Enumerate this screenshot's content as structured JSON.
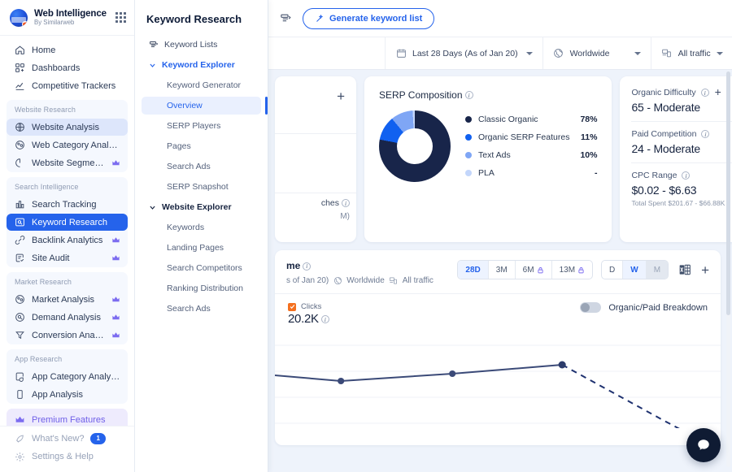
{
  "brand": {
    "name": "Web Intelligence",
    "sub": "By Similarweb"
  },
  "sidebar": {
    "top_items": [
      {
        "label": "Home",
        "icon": "home-icon"
      },
      {
        "label": "Dashboards",
        "icon": "dashboards-icon"
      },
      {
        "label": "Competitive Trackers",
        "icon": "trackers-icon"
      }
    ],
    "groups": [
      {
        "label": "Website Research",
        "items": [
          {
            "label": "Website Analysis",
            "icon": "globe-icon",
            "selected": true,
            "premium": false
          },
          {
            "label": "Web Category Analysis",
            "icon": "category-icon",
            "selected": false,
            "premium": false
          },
          {
            "label": "Website Segments",
            "icon": "segments-icon",
            "selected": false,
            "premium": true
          }
        ]
      },
      {
        "label": "Search Intelligence",
        "items": [
          {
            "label": "Search Tracking",
            "icon": "bars-icon",
            "selected": false,
            "premium": false
          },
          {
            "label": "Keyword Research",
            "icon": "keyword-icon",
            "selected": "hard",
            "premium": false
          },
          {
            "label": "Backlink Analytics",
            "icon": "link-icon",
            "selected": false,
            "premium": true
          },
          {
            "label": "Site Audit",
            "icon": "audit-icon",
            "selected": false,
            "premium": true
          }
        ]
      },
      {
        "label": "Market Research",
        "items": [
          {
            "label": "Market Analysis",
            "icon": "market-icon",
            "selected": false,
            "premium": true
          },
          {
            "label": "Demand Analysis",
            "icon": "demand-icon",
            "selected": false,
            "premium": true
          },
          {
            "label": "Conversion Analysis",
            "icon": "funnel-icon",
            "selected": false,
            "premium": true
          }
        ]
      },
      {
        "label": "App Research",
        "items": [
          {
            "label": "App Category Analysis",
            "icon": "app-category-icon",
            "selected": false,
            "premium": false
          },
          {
            "label": "App Analysis",
            "icon": "phone-icon",
            "selected": false,
            "premium": false
          }
        ]
      }
    ],
    "premium_label": "Premium Features",
    "footer": [
      {
        "label": "What's New?",
        "icon": "rocket-icon",
        "badge": "1"
      },
      {
        "label": "Settings & Help",
        "icon": "gear-icon",
        "badge": ""
      }
    ]
  },
  "subnav": {
    "title": "Keyword Research",
    "items": [
      {
        "label": "Keyword Lists",
        "type": "root",
        "icon": "list-icon"
      },
      {
        "label": "Keyword Explorer",
        "type": "section",
        "expanded": true
      },
      {
        "label": "Keyword Generator",
        "type": "child"
      },
      {
        "label": "Overview",
        "type": "child",
        "active": true
      },
      {
        "label": "SERP Players",
        "type": "child"
      },
      {
        "label": "Pages",
        "type": "child"
      },
      {
        "label": "Search Ads",
        "type": "child"
      },
      {
        "label": "SERP Snapshot",
        "type": "child"
      },
      {
        "label": "Website Explorer",
        "type": "section-dark",
        "expanded": true
      },
      {
        "label": "Keywords",
        "type": "child"
      },
      {
        "label": "Landing Pages",
        "type": "child"
      },
      {
        "label": "Search Competitors",
        "type": "child"
      },
      {
        "label": "Ranking Distribution",
        "type": "child"
      },
      {
        "label": "Search Ads",
        "type": "child"
      }
    ]
  },
  "topbar": {
    "generate_label": "Generate keyword list"
  },
  "filters": {
    "date": "Last 28 Days (As of Jan 20)",
    "geo": "Worldwide",
    "traffic": "All traffic"
  },
  "card_left": {
    "partial_title": "ches",
    "partial_sub": "M)"
  },
  "serp_card": {
    "title": "SERP Composition"
  },
  "metrics": [
    {
      "label": "Organic Difficulty",
      "value": "65 - Moderate",
      "sub": "",
      "has_plus": true
    },
    {
      "label": "Paid Competition",
      "value": "24 - Moderate",
      "sub": "",
      "has_plus": false
    },
    {
      "label": "CPC Range",
      "value": "$0.02 - $6.63",
      "sub": "Total Spent $201.67 - $66.88K",
      "has_plus": false
    }
  ],
  "volume_card": {
    "title": "me",
    "subtitle_parts": [
      "s of Jan 20)",
      "Worldwide",
      "All traffic"
    ],
    "ranges": [
      {
        "label": "28D",
        "state": "on",
        "locked": false
      },
      {
        "label": "3M",
        "state": "",
        "locked": false
      },
      {
        "label": "6M",
        "state": "",
        "locked": true
      },
      {
        "label": "13M",
        "state": "",
        "locked": true
      }
    ],
    "granularity": [
      {
        "label": "D",
        "state": ""
      },
      {
        "label": "W",
        "state": "on"
      },
      {
        "label": "M",
        "state": "dim"
      }
    ],
    "clicks_label": "Clicks",
    "clicks_value": "20.2K",
    "toggle_label": "Organic/Paid Breakdown"
  },
  "colors": {
    "accent": "#2563eb",
    "navy": "#18254a",
    "blue": "#1161f0",
    "light_blue": "#7fa6f5",
    "pale_blue": "#c3d6fb",
    "orange": "#f4701f",
    "premium_purple": "#7c6cf0"
  },
  "chart_data": [
    {
      "type": "pie",
      "title": "SERP Composition",
      "labels": [
        "Classic Organic",
        "Organic SERP Features",
        "Text Ads",
        "PLA"
      ],
      "values": [
        78,
        11,
        10,
        0
      ],
      "display_values": [
        "78%",
        "11%",
        "10%",
        "-"
      ],
      "colors": [
        "#18254a",
        "#1161f0",
        "#7fa6f5",
        "#c3d6fb"
      ],
      "legend_position": "right",
      "donut": true
    },
    {
      "type": "line",
      "title": "me",
      "series": [
        {
          "name": "Clicks",
          "values": [
            20400,
            19600,
            20100,
            20900
          ],
          "x": [
            0,
            1,
            2,
            3
          ],
          "color": "#3b4a78",
          "style": "solid"
        },
        {
          "name": "Clicks (forecast)",
          "values": [
            20900,
            17400
          ],
          "x": [
            3,
            4
          ],
          "color": "#1f3270",
          "style": "dashed"
        }
      ],
      "grid": true,
      "xlabel": "",
      "ylabel": "",
      "total_label": "20.2K"
    }
  ]
}
